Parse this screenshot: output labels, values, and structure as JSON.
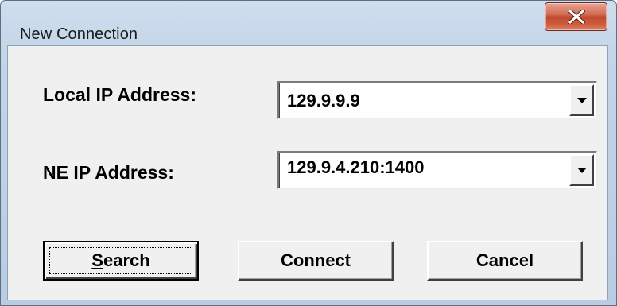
{
  "window": {
    "title": "New Connection"
  },
  "form": {
    "local_ip_label": "Local IP Address:",
    "local_ip_value": "129.9.9.9",
    "ne_ip_label": "NE IP Address:",
    "ne_ip_value": "129.9.4.210:1400"
  },
  "buttons": {
    "search_mnemonic": "S",
    "search_rest": "earch",
    "connect": "Connect",
    "cancel": "Cancel"
  },
  "icons": {
    "close": "close-icon",
    "dropdown": "chevron-down-icon"
  },
  "colors": {
    "close_button": "#c14a30",
    "dialog_face": "#f0f0f0",
    "frame": "#c3d5e8"
  }
}
